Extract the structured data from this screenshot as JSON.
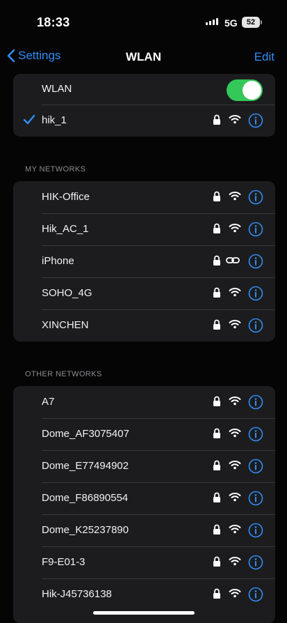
{
  "status_bar": {
    "time": "18:33",
    "network_type": "5G",
    "battery_level": "52"
  },
  "nav": {
    "back_label": "Settings",
    "title": "WLAN",
    "edit_label": "Edit"
  },
  "wlan": {
    "toggle_label": "WLAN",
    "toggle_on": true,
    "connected_network": "hik_1"
  },
  "my_networks": {
    "header": "MY NETWORKS",
    "items": [
      {
        "name": "HIK-Office",
        "secured": true,
        "icon": "wifi-icon"
      },
      {
        "name": "Hik_AC_1",
        "secured": true,
        "icon": "wifi-icon"
      },
      {
        "name": "iPhone",
        "secured": true,
        "icon": "hotspot-link-icon"
      },
      {
        "name": "SOHO_4G",
        "secured": true,
        "icon": "wifi-icon"
      },
      {
        "name": "XINCHEN",
        "secured": true,
        "icon": "wifi-icon"
      }
    ]
  },
  "other_networks": {
    "header": "OTHER NETWORKS",
    "items": [
      {
        "name": "A7",
        "secured": true,
        "icon": "wifi-icon"
      },
      {
        "name": "Dome_AF3075407",
        "secured": true,
        "icon": "wifi-icon"
      },
      {
        "name": "Dome_E77494902",
        "secured": true,
        "icon": "wifi-icon"
      },
      {
        "name": "Dome_F86890554",
        "secured": true,
        "icon": "wifi-icon"
      },
      {
        "name": "Dome_K25237890",
        "secured": true,
        "icon": "wifi-icon"
      },
      {
        "name": "F9-E01-3",
        "secured": true,
        "icon": "wifi-icon"
      },
      {
        "name": "Hik-J45736138",
        "secured": true,
        "icon": "wifi-icon"
      }
    ]
  },
  "colors": {
    "accent": "#2f8ef5",
    "toggle_on": "#34c759",
    "group_bg": "#1c1c1e",
    "background": "#050505"
  }
}
